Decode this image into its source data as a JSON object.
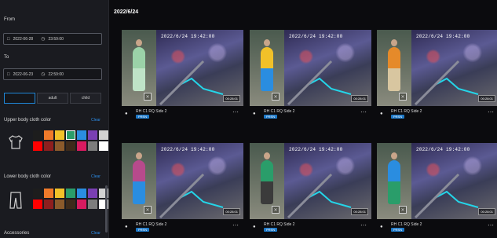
{
  "sidebar": {
    "from_label": "From",
    "from_date": "2022-06-28",
    "from_time": "23:59:00",
    "to_label": "To",
    "to_date": "2022-06-23",
    "to_time": "22:59:00",
    "segments": [
      "",
      "adult",
      "child"
    ],
    "upper_label": "Upper body cloth color",
    "lower_label": "Lower body cloth color",
    "accessories_label": "Accessories",
    "clear": "Clear",
    "colors": [
      "#1d1d1d",
      "#ef7a2a",
      "#f1c129",
      "#2a9d6a",
      "#2a8de0",
      "#7a3fb3",
      "#d2d2d2",
      "#ff0000",
      "#8e1e1e",
      "#8b5a2b",
      "#3d2a1a",
      "#d81b60",
      "#7d7d7d",
      "#ffffff"
    ]
  },
  "main": {
    "date_heading": "2022/6/24",
    "cards": [
      {
        "time": "2022/6/24 19:42:00",
        "name": "RH C1 RQ Side 2",
        "tag": "PRSN",
        "shirt": "#9bd2a8",
        "pants": "#bfe3c7",
        "small": "00:28:01"
      },
      {
        "time": "2022/6/24 19:42:00",
        "name": "RH C1 RQ Side 2",
        "tag": "PRSN",
        "shirt": "#f1c129",
        "pants": "#2a8de0",
        "small": "00:28:01"
      },
      {
        "time": "2022/6/24 19:42:00",
        "name": "RH C1 RQ Side 2",
        "tag": "PRSN",
        "shirt": "#e58a2a",
        "pants": "#d8c6a0",
        "small": "00:28:01"
      },
      {
        "time": "2022/6/24 19:42:00",
        "name": "RH C1 RQ Side 2",
        "tag": "PRSN",
        "shirt": "#b74a8c",
        "pants": "#2a8de0",
        "small": "00:28:01"
      },
      {
        "time": "2022/6/24 19:42:00",
        "name": "RH C1 RQ Side 2",
        "tag": "PRSN",
        "shirt": "#2a9d6a",
        "pants": "#3b3b3b",
        "small": "00:28:01"
      },
      {
        "time": "2022/6/24 19:42:00",
        "name": "RH C1 RQ Side 2",
        "tag": "PRSN",
        "shirt": "#2a8de0",
        "pants": "#2a9d6a",
        "small": "00:28:01"
      }
    ]
  }
}
